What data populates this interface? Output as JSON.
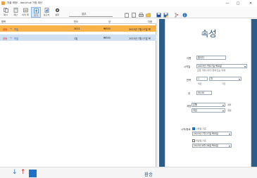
{
  "window": {
    "title": "지출 재정! - danichuk 가정 재산",
    "controls": [
      "—",
      "□",
      "✕"
    ]
  },
  "toolbar": {
    "buttons": [
      {
        "label": "복사",
        "icon": "copy-icon"
      },
      {
        "label": "계산",
        "icon": "calculator-icon"
      },
      {
        "label": "이의 계",
        "icon": "account-icon"
      },
      {
        "label": "추가",
        "icon": "add-icon"
      },
      {
        "label": "보고서",
        "icon": "report-icon"
      },
      {
        "label": "설정",
        "icon": "gear-icon"
      }
    ],
    "group_label": "업무",
    "group_icons": {
      "plus": "+",
      "copy": "⧉",
      "minus": "−"
    },
    "right_icons": [
      "clipboard-icon",
      "paste-icon",
      "print-icon",
      "folder-icon",
      "save-icon",
      "save-as-icon",
      "filter-icon",
      "info-icon"
    ]
  },
  "list": {
    "headers": {
      "item": "항목",
      "frequency": "빈도",
      "amount": "양",
      "next": "다음"
    },
    "rows": [
      {
        "tag": "공동",
        "arrow": "→",
        "name": "차입",
        "frequency": "3021",
        "amount": "₩300",
        "next": "2023년 7월 27일 목"
      },
      {
        "tag": "공동",
        "arrow": "→",
        "name": "차입",
        "frequency": "1일",
        "amount": "₩350",
        "next": "2023년 7월 27일 목"
      }
    ]
  },
  "bottom": {
    "summary": "환승"
  },
  "panel": {
    "title": "속성",
    "name_label": "이름",
    "name_value": "출이다",
    "start_label": "시작일",
    "start_value": "2023년 7월27일 목요일",
    "start_hint": "포함 거래 (과거, 현재 또는 미래",
    "repeat_label": "반복",
    "repeat_num": "1",
    "repeat_unit": "월",
    "repeat_sub1": "어린",
    "repeat_sub2": "기간",
    "amount_label": "양",
    "amount_value": "50.00",
    "category_label": "계정",
    "category_value": "은행",
    "category_suffix": "계좌",
    "category2_value": "차입",
    "category2_suffix": "계정",
    "schedule_label": "시작/종료",
    "opt1_label": "시작일 기준",
    "opt1_date": "2023년 7월 27일 목요일",
    "opt2_label": "마감일 기준",
    "opt2_date": "2023년 8월 28일 목요일"
  }
}
